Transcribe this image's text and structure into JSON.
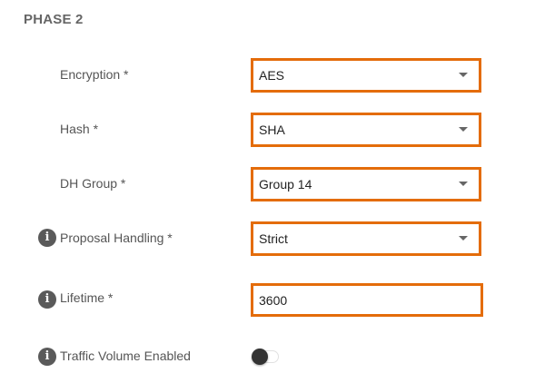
{
  "section": {
    "title": "PHASE 2"
  },
  "fields": {
    "encryption": {
      "label": "Encryption *",
      "value": "AES"
    },
    "hash": {
      "label": "Hash *",
      "value": "SHA"
    },
    "dh_group": {
      "label": "DH Group *",
      "value": "Group 14"
    },
    "proposal_handling": {
      "label": "Proposal Handling *",
      "value": "Strict"
    },
    "lifetime": {
      "label": "Lifetime *",
      "value": "3600"
    },
    "traffic_volume": {
      "label": "Traffic Volume Enabled",
      "enabled": false
    }
  },
  "icons": {
    "info": "info-icon",
    "dropdown": "chevron-down-icon"
  },
  "colors": {
    "highlight_border": "#e46c0a",
    "toggle_knob": "#333333"
  }
}
